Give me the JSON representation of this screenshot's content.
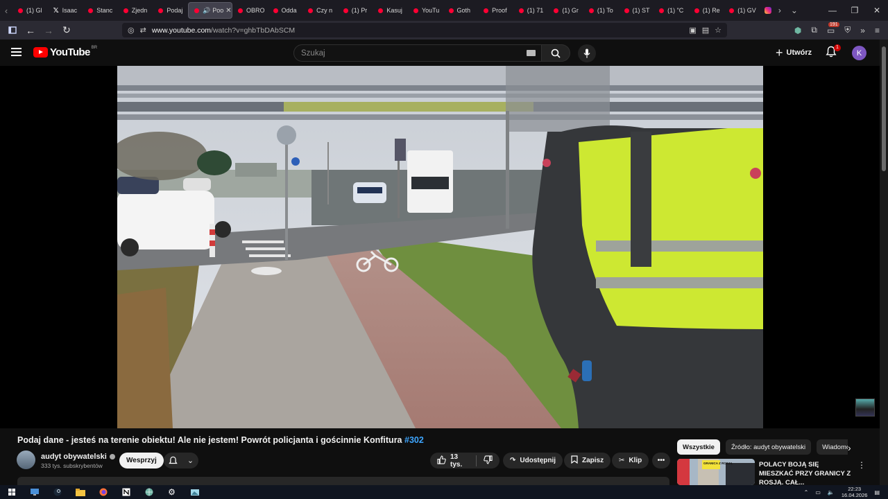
{
  "browser": {
    "tabs": [
      {
        "label": "(1) Gl",
        "icon": "youtube-icon"
      },
      {
        "label": "Isaac",
        "icon": "x-icon"
      },
      {
        "label": "Stanc",
        "icon": "youtube-icon"
      },
      {
        "label": "Zjedn",
        "icon": "youtube-icon"
      },
      {
        "label": "Podaj",
        "icon": "youtube-icon"
      },
      {
        "label": "Poo",
        "icon": "youtube-icon",
        "active": true
      },
      {
        "label": "OBRO",
        "icon": "youtube-icon"
      },
      {
        "label": "Odda",
        "icon": "youtube-icon"
      },
      {
        "label": "Czy n",
        "icon": "youtube-icon"
      },
      {
        "label": "(1) Pr",
        "icon": "youtube-icon"
      },
      {
        "label": "Kasuj",
        "icon": "youtube-icon"
      },
      {
        "label": "YouTu",
        "icon": "youtube-icon"
      },
      {
        "label": "Goth",
        "icon": "youtube-icon"
      },
      {
        "label": "Proof",
        "icon": "youtube-icon"
      },
      {
        "label": "(1) 71",
        "icon": "youtube-icon"
      },
      {
        "label": "(1) Gr",
        "icon": "youtube-icon"
      },
      {
        "label": "(1) To",
        "icon": "youtube-icon"
      },
      {
        "label": "(1) ST",
        "icon": "youtube-icon"
      },
      {
        "label": "(1) \"C",
        "icon": "youtube-icon"
      },
      {
        "label": "(1) Re",
        "icon": "youtube-icon"
      },
      {
        "label": "(1) GV",
        "icon": "youtube-icon"
      }
    ],
    "url_host": "www.youtube.com",
    "url_path": "/watch?v=ghbTbDAbSCM",
    "extension_badge": "191"
  },
  "youtube": {
    "logo_text": "YouTube",
    "country_code": "BR",
    "search_placeholder": "Szukaj",
    "create_label": "Utwórz",
    "notification_count": "1",
    "avatar_letter": "K"
  },
  "video": {
    "title": "Podaj dane - jesteś na terenie obiektu! Ale nie jestem! Powrót policjanta i gościnnie Konfitura",
    "hashtag": "#302",
    "channel_name": "audyt obywatelski",
    "subscribers": "333 tys. subskrybentów",
    "support_label": "Wesprzyj",
    "like_count": "13 tys.",
    "share_label": "Udostępnij",
    "save_label": "Zapisz",
    "clip_label": "Klip"
  },
  "sidebar": {
    "chips": [
      "Wszystkie",
      "Źródło: audyt obywatelski",
      "Wiadomości"
    ],
    "recommendation": {
      "title": "POLACY BOJĄ SIĘ MIESZKAĆ PRZY GRANICY Z ROSJĄ. CAŁ...",
      "thumb_text": "GRANICA Z ROSJĄ"
    }
  },
  "taskbar": {
    "time": "22:23",
    "date": "16.04.2026"
  }
}
